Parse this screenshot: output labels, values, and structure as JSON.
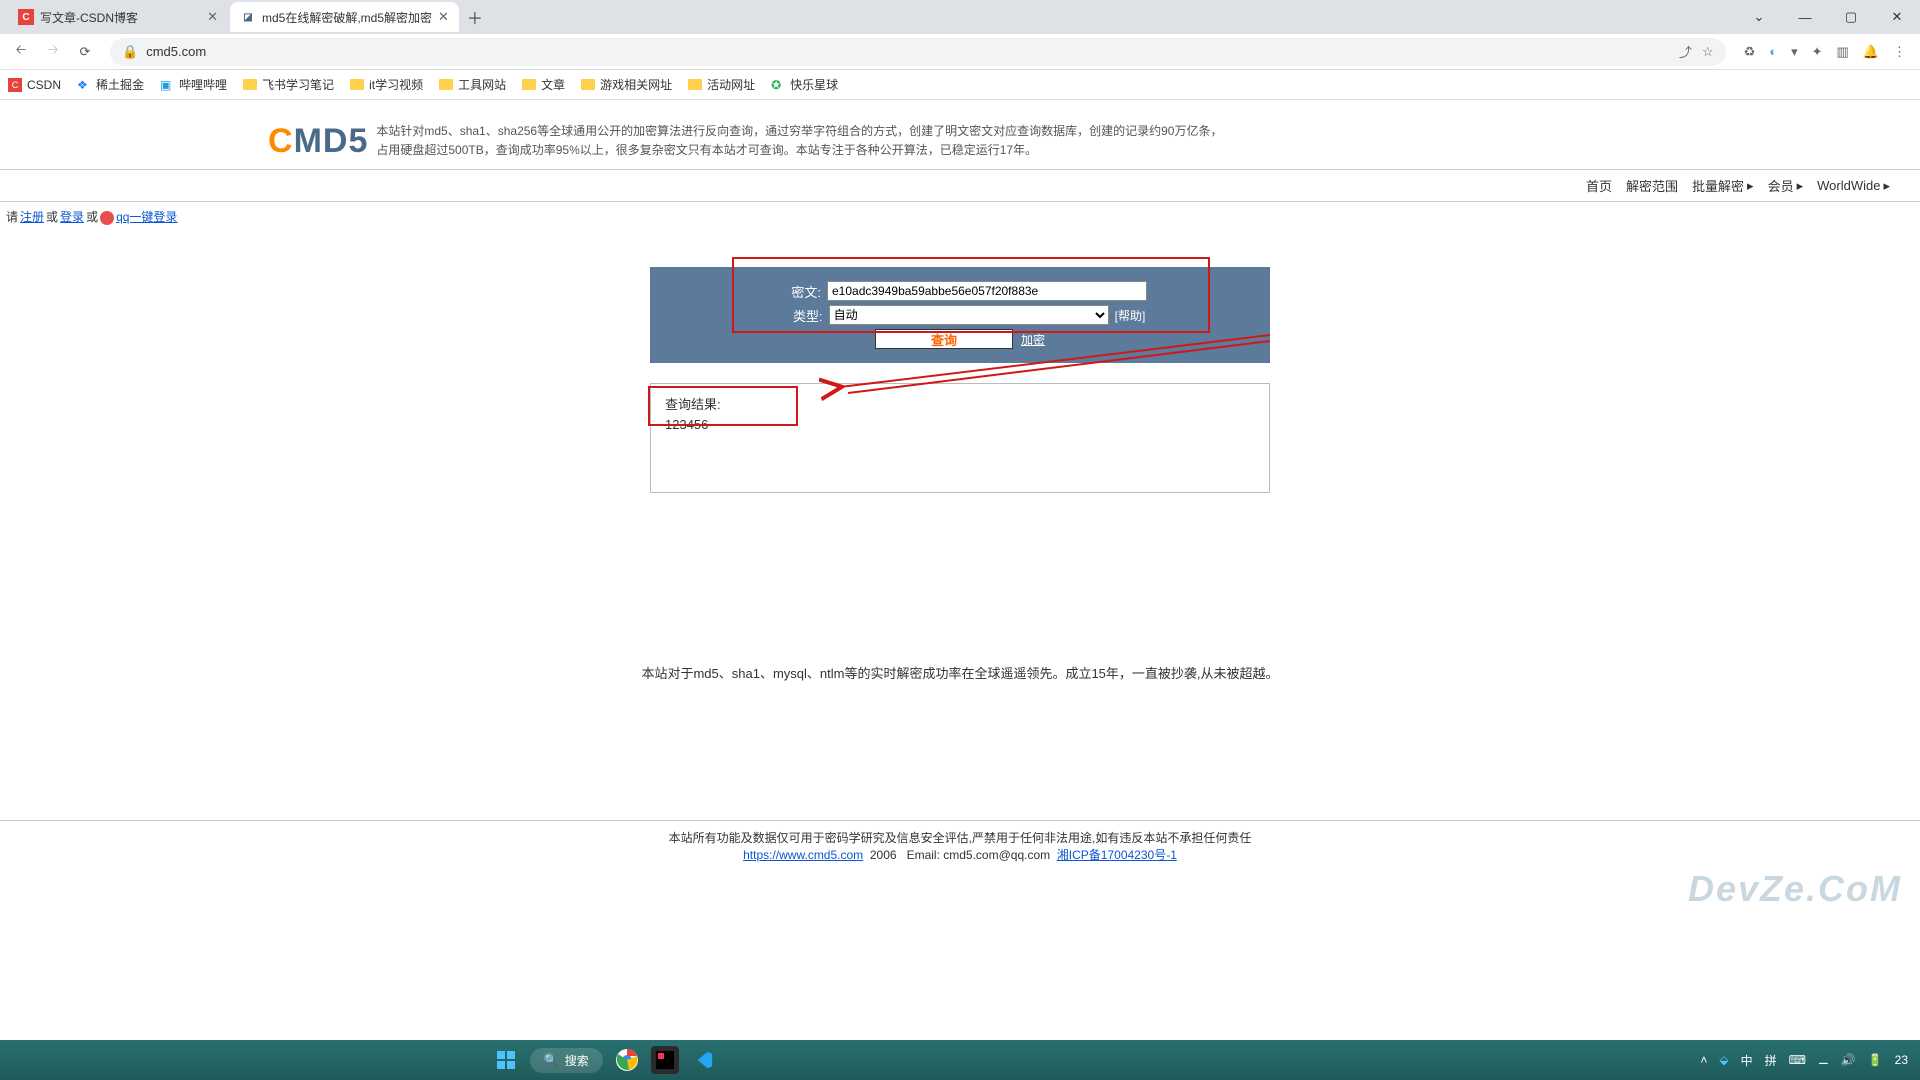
{
  "browser": {
    "tabs": [
      {
        "title": "写文章-CSDN博客",
        "favicon": "C",
        "favicon_bg": "#e8433a"
      },
      {
        "title": "md5在线解密破解,md5解密加密",
        "favicon": "◪",
        "favicon_bg": "#4a6a8a"
      }
    ],
    "address": "cmd5.com",
    "bookmarks": [
      {
        "label": "CSDN",
        "type": "icon",
        "color": "#e8433a"
      },
      {
        "label": "稀土掘金",
        "type": "icon",
        "color": "#1e80ff"
      },
      {
        "label": "哔哩哔哩",
        "type": "icon",
        "color": "#20a0da"
      },
      {
        "label": "飞书学习笔记",
        "type": "folder"
      },
      {
        "label": "it学习视频",
        "type": "folder"
      },
      {
        "label": "工具网站",
        "type": "folder"
      },
      {
        "label": "文章",
        "type": "folder"
      },
      {
        "label": "游戏相关网址",
        "type": "folder"
      },
      {
        "label": "活动网址",
        "type": "folder"
      },
      {
        "label": "快乐星球",
        "type": "icon",
        "color": "#22b14c"
      }
    ]
  },
  "page": {
    "logo_c": "C",
    "logo_md5": "MD5",
    "desc_line1": "本站针对md5、sha1、sha256等全球通用公开的加密算法进行反向查询，通过穷举字符组合的方式，创建了明文密文对应查询数据库，创建的记录约90万亿条，",
    "desc_line2": "占用硬盘超过500TB，查询成功率95%以上，很多复杂密文只有本站才可查询。本站专注于各种公开算法，已稳定运行17年。",
    "menu": {
      "home": "首页",
      "scope": "解密范围",
      "batch": "批量解密",
      "member": "会员",
      "worldwide": "WorldWide"
    },
    "login": {
      "prefix": "请",
      "register": "注册",
      "or1": "或",
      "login": "登录",
      "or2": "或",
      "qq": "qq一键登录"
    },
    "form": {
      "cipher_label": "密文:",
      "cipher_value": "e10adc3949ba59abbe56e057f20f883e",
      "type_label": "类型:",
      "type_value": "自动",
      "help": "[帮助]",
      "query_btn": "查询",
      "encrypt_link": "加密"
    },
    "result": {
      "label": "查询结果:",
      "value": "123456"
    },
    "footer_desc": "本站对于md5、sha1、mysql、ntlm等的实时解密成功率在全球遥遥领先。成立15年，一直被抄袭,从未被超越。",
    "footer_legal": {
      "line1": "本站所有功能及数据仅可用于密码学研究及信息安全评估,严禁用于任何非法用途,如有违反本站不承担任何责任",
      "url": "https://www.cmd5.com",
      "year": "2006",
      "email_label": "Email: cmd5.com@qq.com",
      "icp": "湘ICP备17004230号-1"
    },
    "watermark": "DevZe.CoM"
  },
  "taskbar": {
    "search": "搜索",
    "ime1": "中",
    "ime2": "拼",
    "time": "23"
  }
}
